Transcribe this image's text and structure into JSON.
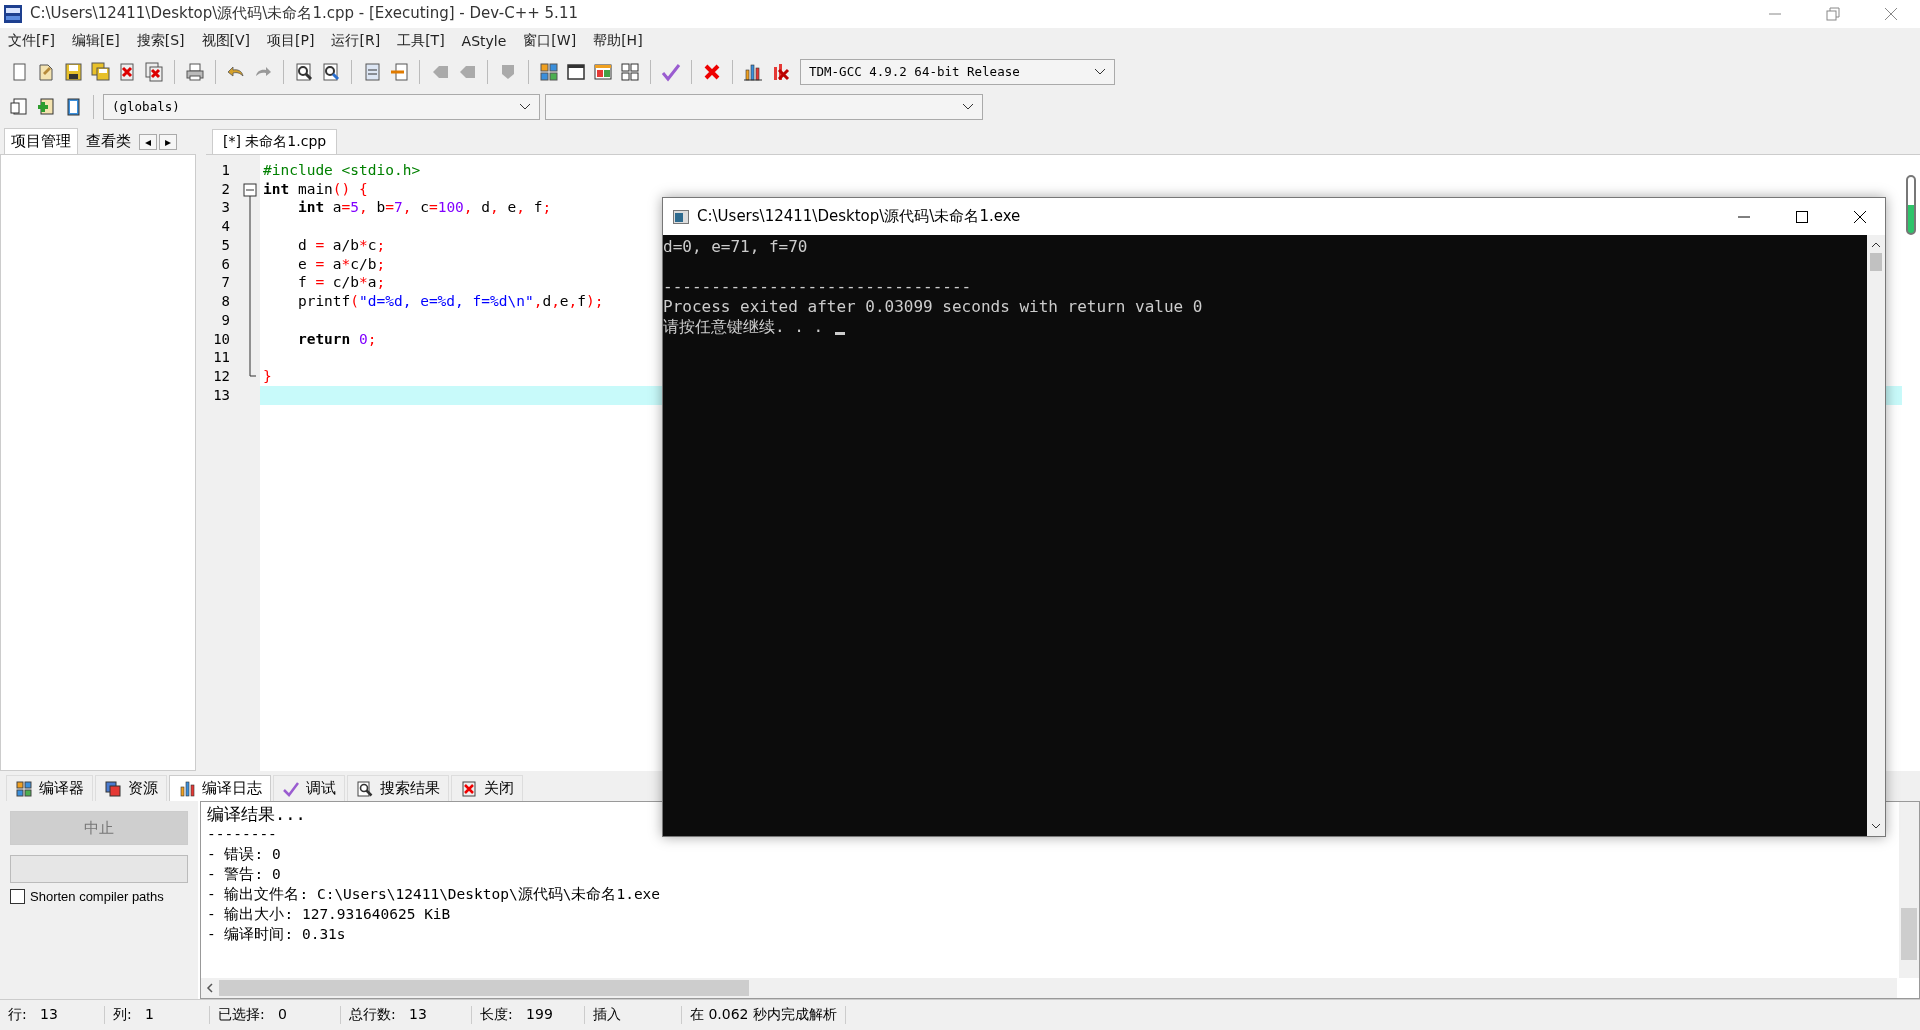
{
  "window": {
    "title": "C:\\Users\\12411\\Desktop\\源代码\\未命名1.cpp - [Executing] - Dev-C++ 5.11"
  },
  "menu": [
    "文件[F]",
    "编辑[E]",
    "搜索[S]",
    "视图[V]",
    "项目[P]",
    "运行[R]",
    "工具[T]",
    "AStyle",
    "窗口[W]",
    "帮助[H]"
  ],
  "toolbar": {
    "compiler": "TDM-GCC 4.9.2 64-bit Release",
    "scope": "(globals)"
  },
  "left_tabs": [
    {
      "label": "项目管理",
      "selected": true
    },
    {
      "label": "查看类",
      "selected": false
    }
  ],
  "tab_arrows": [
    "◂",
    "▸"
  ],
  "editor_tab": {
    "label": "[*] 未命名1.cpp",
    "selected": true
  },
  "code": [
    {
      "number": "1",
      "current": false,
      "tokens": [
        {
          "kind": "preproc",
          "text": "#include <stdio.h>"
        }
      ]
    },
    {
      "number": "2",
      "current": false,
      "tokens": [
        {
          "kind": "keyword",
          "text": "int"
        },
        {
          "kind": "plain",
          "text": " main"
        },
        {
          "kind": "symbol",
          "text": "() {"
        }
      ]
    },
    {
      "number": "3",
      "current": false,
      "tokens": [
        {
          "kind": "keyword",
          "text": "    int"
        },
        {
          "kind": "plain",
          "text": " a"
        },
        {
          "kind": "symbol",
          "text": "="
        },
        {
          "kind": "number",
          "text": "5"
        },
        {
          "kind": "symbol",
          "text": ","
        },
        {
          "kind": "plain",
          "text": " b"
        },
        {
          "kind": "symbol",
          "text": "="
        },
        {
          "kind": "number",
          "text": "7"
        },
        {
          "kind": "symbol",
          "text": ","
        },
        {
          "kind": "plain",
          "text": " c"
        },
        {
          "kind": "symbol",
          "text": "="
        },
        {
          "kind": "number",
          "text": "100"
        },
        {
          "kind": "symbol",
          "text": ","
        },
        {
          "kind": "plain",
          "text": " d"
        },
        {
          "kind": "symbol",
          "text": ","
        },
        {
          "kind": "plain",
          "text": " e"
        },
        {
          "kind": "symbol",
          "text": ","
        },
        {
          "kind": "plain",
          "text": " f"
        },
        {
          "kind": "symbol",
          "text": ";"
        }
      ]
    },
    {
      "number": "4",
      "current": false
    },
    {
      "number": "5",
      "current": false,
      "tokens": [
        {
          "kind": "plain",
          "text": "    d "
        },
        {
          "kind": "symbol",
          "text": "="
        },
        {
          "kind": "plain",
          "text": " a/b"
        },
        {
          "kind": "symbol",
          "text": "*"
        },
        {
          "kind": "plain",
          "text": "c"
        },
        {
          "kind": "symbol",
          "text": ";"
        }
      ]
    },
    {
      "number": "6",
      "current": false,
      "tokens": [
        {
          "kind": "plain",
          "text": "    e "
        },
        {
          "kind": "symbol",
          "text": "="
        },
        {
          "kind": "plain",
          "text": " a"
        },
        {
          "kind": "symbol",
          "text": "*"
        },
        {
          "kind": "plain",
          "text": "c/b"
        },
        {
          "kind": "symbol",
          "text": ";"
        }
      ]
    },
    {
      "number": "7",
      "current": false,
      "tokens": [
        {
          "kind": "plain",
          "text": "    f "
        },
        {
          "kind": "symbol",
          "text": "="
        },
        {
          "kind": "plain",
          "text": " c/b"
        },
        {
          "kind": "symbol",
          "text": "*"
        },
        {
          "kind": "plain",
          "text": "a"
        },
        {
          "kind": "symbol",
          "text": ";"
        }
      ]
    },
    {
      "number": "8",
      "current": false,
      "tokens": [
        {
          "kind": "plain",
          "text": "    printf"
        },
        {
          "kind": "symbol",
          "text": "("
        },
        {
          "kind": "string",
          "text": "\"d=%d, e=%d, f=%d\\n\""
        },
        {
          "kind": "symbol",
          "text": ","
        },
        {
          "kind": "plain",
          "text": "d"
        },
        {
          "kind": "symbol",
          "text": ","
        },
        {
          "kind": "plain",
          "text": "e"
        },
        {
          "kind": "symbol",
          "text": ","
        },
        {
          "kind": "plain",
          "text": "f"
        },
        {
          "kind": "symbol",
          "text": ");"
        }
      ]
    },
    {
      "number": "9",
      "current": false
    },
    {
      "number": "10",
      "current": false,
      "tokens": [
        {
          "kind": "keyword",
          "text": "    return"
        },
        {
          "kind": "number",
          "text": " 0"
        },
        {
          "kind": "symbol",
          "text": ";"
        }
      ]
    },
    {
      "number": "11",
      "current": false
    },
    {
      "number": "12",
      "current": false,
      "tokens": [
        {
          "kind": "symbol",
          "text": "}"
        }
      ]
    },
    {
      "number": "13",
      "current": true
    }
  ],
  "console": {
    "title": "C:\\Users\\12411\\Desktop\\源代码\\未命名1.exe",
    "cursor": true,
    "blocks": [
      {
        "lines": [
          "d=0, e=71, f=70"
        ]
      },
      {
        "lines": [
          "--------------------------------",
          "Process exited after 0.03099 seconds with return value 0",
          "请按任意键继续. . ."
        ]
      }
    ]
  },
  "bottom_tabs": [
    {
      "label": "编译器",
      "selected": false
    },
    {
      "label": "资源",
      "selected": false
    },
    {
      "label": "编译日志",
      "selected": true
    },
    {
      "label": "调试",
      "selected": false
    },
    {
      "label": "搜索结果",
      "selected": false
    },
    {
      "label": "关闭",
      "selected": false
    }
  ],
  "compile_panel": {
    "abort_button": {
      "label": "中止",
      "disabled": true
    },
    "progress": {
      "level": 0
    },
    "shorten_paths": {
      "label": "Shorten compiler paths",
      "checked": false
    }
  },
  "log": [
    "编译结果...",
    "--------",
    "- 错误: 0",
    "- 警告: 0",
    "- 输出文件名: C:\\Users\\12411\\Desktop\\源代码\\未命名1.exe",
    "- 输出大小: 127.931640625 KiB",
    "- 编译时间: 0.31s"
  ],
  "status_bar": [
    {
      "label": "行:",
      "value": "13"
    },
    {
      "label": "列:",
      "value": "1"
    },
    {
      "label": "已选择:",
      "value": "0"
    },
    {
      "label": "总行数:",
      "value": "13"
    },
    {
      "label": "长度:",
      "value": "199"
    },
    {
      "label": "插入"
    },
    {
      "label": "在 0.062 秒内完成解析"
    }
  ]
}
